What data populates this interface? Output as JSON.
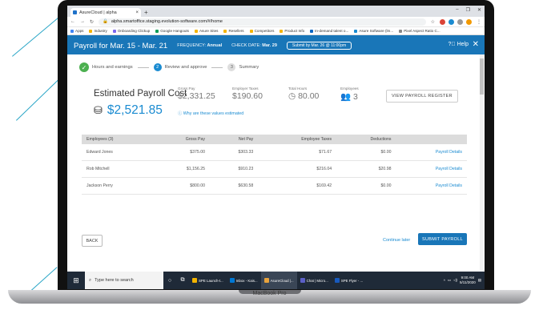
{
  "browser": {
    "tab_title": "AsureCloud | alpha",
    "tab_close": "×",
    "new_tab": "+",
    "url": "alpha.smartoffice.staging.evolution-software.com/#/home",
    "window_controls": [
      "–",
      "❐",
      "✕"
    ],
    "bookmarks": [
      {
        "label": "Apps",
        "color": "#4285f4"
      },
      {
        "label": "Industry",
        "color": "#f4b400"
      },
      {
        "label": "Onboarding Clickup",
        "color": "#7b68ee"
      },
      {
        "label": "Google Hangouts",
        "color": "#0f9d58"
      },
      {
        "label": "Asure Sites",
        "color": "#f4b400"
      },
      {
        "label": "Resellers",
        "color": "#f4b400"
      },
      {
        "label": "Competitors",
        "color": "#f4b400"
      },
      {
        "label": "Product Info",
        "color": "#f4b400"
      },
      {
        "label": "In-demand talent o...",
        "color": "#0a66c2"
      },
      {
        "label": "Asure Software (lm...",
        "color": "#1a8bd1"
      },
      {
        "label": "Pixel Aspect Ratio C...",
        "color": "#888888"
      }
    ]
  },
  "header": {
    "title": "Payroll for Mar. 15 - Mar. 21",
    "frequency_label": "FREQUENCY:",
    "frequency_value": "Annual",
    "check_date_label": "CHECK DATE:",
    "check_date_value": "Mar. 29",
    "submit_by": "Submit by Mar. 26 @ 11:00pm",
    "help": "Help",
    "close": "✕"
  },
  "steps": [
    {
      "label": "Hours and earnings",
      "state": "done"
    },
    {
      "number": "2",
      "label": "Review and approve",
      "state": "active"
    },
    {
      "number": "3",
      "label": "Summary",
      "state": "upcoming"
    }
  ],
  "estimate": {
    "title": "Estimated Payroll Cost",
    "total": "$2,521.85",
    "gross_pay_label": "Gross Pay",
    "gross_pay": "$2,331.25",
    "employer_taxes_label": "Employer Taxes",
    "employer_taxes": "$190.60",
    "total_hours_label": "Total Hours",
    "total_hours": "80.00",
    "employees_label": "Employees",
    "employees": "3",
    "why_link": "Why are these values estimated",
    "view_register": "VIEW PAYROLL REGISTER"
  },
  "table": {
    "headers": [
      "Employees (3)",
      "Gross Pay",
      "Net Pay",
      "Employee Taxes",
      "Deductions",
      ""
    ],
    "rows": [
      {
        "name": "Edward Jones",
        "gross": "$375.00",
        "net": "$303.33",
        "taxes": "$71.67",
        "deductions": "$0.00",
        "link": "Payroll Details"
      },
      {
        "name": "Rob Mitchell",
        "gross": "$1,156.25",
        "net": "$910.23",
        "taxes": "$216.04",
        "deductions": "$20.98",
        "link": "Payroll Details"
      },
      {
        "name": "Jackson Perry",
        "gross": "$800.00",
        "net": "$630.58",
        "taxes": "$169.42",
        "deductions": "$0.00",
        "link": "Payroll Details"
      }
    ]
  },
  "footer": {
    "back": "BACK",
    "continue_later": "Continue later",
    "submit": "SUBMIT PAYROLL"
  },
  "taskbar": {
    "search_placeholder": "Type here to search",
    "apps": [
      {
        "label": "SPE Launch-t...",
        "color": "#f4b400"
      },
      {
        "label": "Inbox - Kais...",
        "color": "#0078d4"
      },
      {
        "label": "AsureCloud |...",
        "color": "#e8a33d"
      },
      {
        "label": "Chat | Micro...",
        "color": "#5b5fc7"
      },
      {
        "label": "SPE Flyer - ...",
        "color": "#185abd"
      }
    ],
    "time": "9:00 AM",
    "date": "5/11/2020"
  },
  "laptop_label": "MacBook Pro"
}
